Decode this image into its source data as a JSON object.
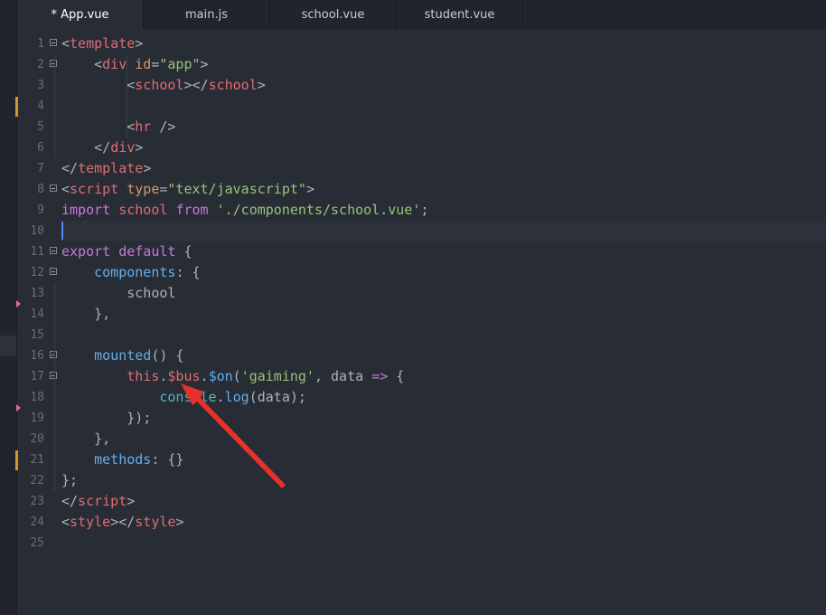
{
  "tabs": [
    {
      "label": "* App.vue",
      "active": true
    },
    {
      "label": "main.js",
      "active": false
    },
    {
      "label": "school.vue",
      "active": false
    },
    {
      "label": "student.vue",
      "active": false
    }
  ],
  "line_numbers": [
    "1",
    "2",
    "3",
    "4",
    "5",
    "6",
    "7",
    "8",
    "9",
    "10",
    "11",
    "12",
    "13",
    "14",
    "15",
    "16",
    "17",
    "18",
    "19",
    "20",
    "21",
    "22",
    "23",
    "24",
    "25"
  ],
  "code": {
    "l1": {
      "a": "<",
      "b": "template",
      "c": ">"
    },
    "l2": {
      "indent": "    ",
      "a": "<",
      "b": "div",
      "c": " ",
      "d": "id",
      "e": "=",
      "f": "\"app\"",
      "g": ">"
    },
    "l3": {
      "indent": "        ",
      "a": "<",
      "b": "school",
      "c": "></",
      "d": "school",
      "e": ">"
    },
    "l5": {
      "indent": "        ",
      "a": "<",
      "b": "hr",
      "c": " />"
    },
    "l6": {
      "indent": "    ",
      "a": "</",
      "b": "div",
      "c": ">"
    },
    "l7": {
      "a": "</",
      "b": "template",
      "c": ">"
    },
    "l8": {
      "a": "<",
      "b": "script",
      "c": " ",
      "d": "type",
      "e": "=",
      "f": "\"text/javascript\"",
      "g": ">"
    },
    "l9": {
      "a": "import",
      "b": " ",
      "c": "school",
      "d": " ",
      "e": "from",
      "f": " ",
      "g": "'./components/school.vue'",
      "h": ";"
    },
    "l11": {
      "a": "export",
      "b": " ",
      "c": "default",
      "d": " {"
    },
    "l12": {
      "indent": "    ",
      "a": "components",
      "b": ": {"
    },
    "l13": {
      "indent": "        ",
      "a": "school"
    },
    "l14": {
      "indent": "    ",
      "a": "},"
    },
    "l16": {
      "indent": "    ",
      "a": "mounted",
      "b": "() {"
    },
    "l17": {
      "indent": "        ",
      "a": "this",
      "b": ".",
      "c": "$bus",
      "d": ".",
      "e": "$on",
      "f": "(",
      "g": "'gaiming'",
      "h": ", data ",
      "i": "=>",
      "j": " {"
    },
    "l18": {
      "indent": "            ",
      "a": "console",
      "b": ".",
      "c": "log",
      "d": "(data);"
    },
    "l19": {
      "indent": "        ",
      "a": "});"
    },
    "l20": {
      "indent": "    ",
      "a": "},"
    },
    "l21": {
      "indent": "    ",
      "a": "methods",
      "b": ": {}"
    },
    "l22": {
      "a": "};"
    },
    "l23": {
      "a": "</",
      "b": "script",
      "c": ">"
    },
    "l24": {
      "a": "<",
      "b": "style",
      "c": "></",
      "d": "style",
      "e": ">"
    }
  },
  "colors": {
    "background": "#282c34",
    "arrow": "#e8312a",
    "tag": "#e06c75",
    "string": "#98c379",
    "keyword": "#c678dd"
  }
}
